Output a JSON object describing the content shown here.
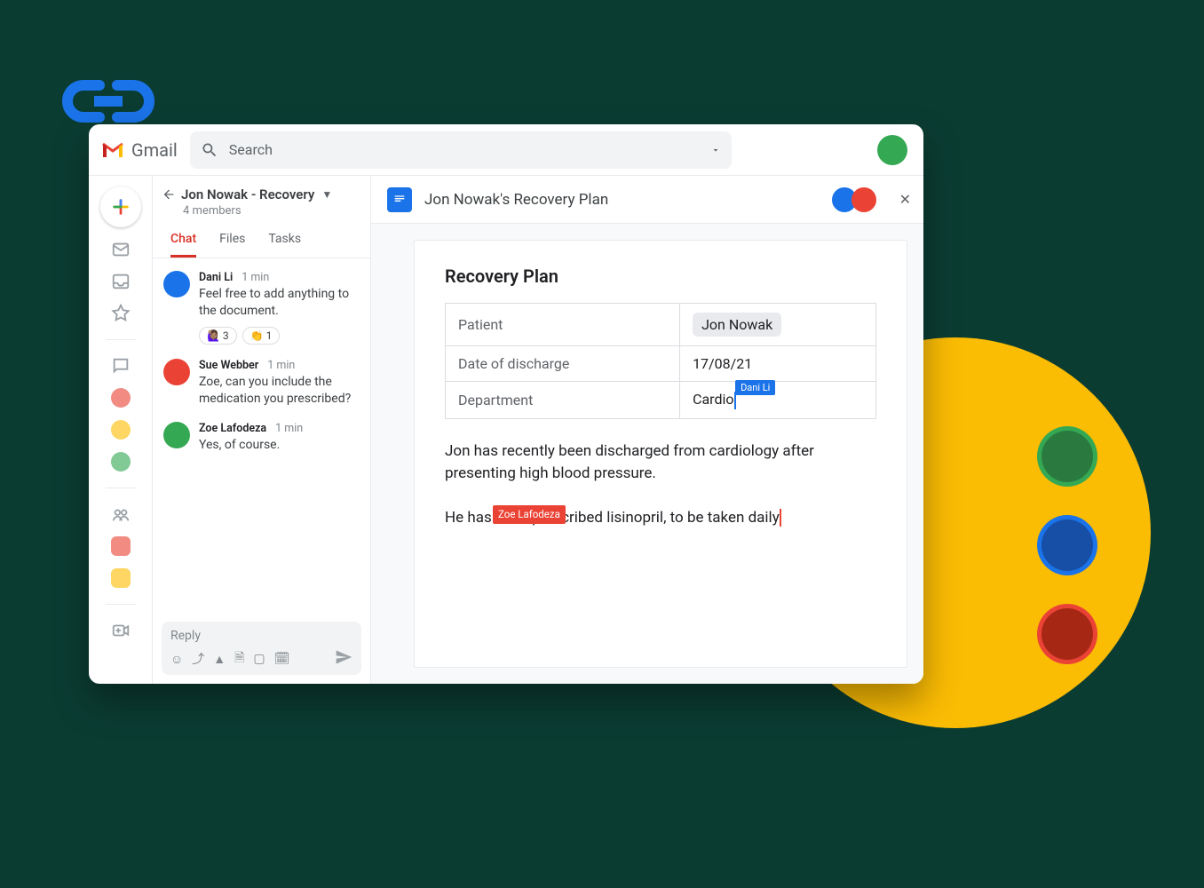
{
  "app": {
    "name": "Gmail",
    "search_placeholder": "Search"
  },
  "space": {
    "title": "Jon Nowak - Recovery",
    "members_label": "4 members",
    "tabs": [
      "Chat",
      "Files",
      "Tasks"
    ],
    "active_tab": "Chat"
  },
  "messages": [
    {
      "author": "Dani Li",
      "time": "1 min",
      "text": "Feel free to add anything to the document.",
      "avatar_color": "#1a73e8",
      "reactions": [
        {
          "emoji": "🙋🏽‍♀️",
          "count": "3"
        },
        {
          "emoji": "👏",
          "count": "1"
        }
      ]
    },
    {
      "author": "Sue Webber",
      "time": "1 min",
      "text": "Zoe, can you include the medication you prescribed?",
      "avatar_color": "#ea4335",
      "reactions": []
    },
    {
      "author": "Zoe Lafodeza",
      "time": "1 min",
      "text": "Yes, of course.",
      "avatar_color": "#34a853",
      "reactions": []
    }
  ],
  "reply": {
    "placeholder": "Reply"
  },
  "document": {
    "title": "Jon Nowak's Recovery Plan",
    "heading": "Recovery Plan",
    "collaborators": [
      {
        "name": "Dani Li",
        "color": "#1a73e8"
      },
      {
        "name": "Zoe Lafodeza",
        "color": "#ea4335"
      }
    ],
    "rows": [
      {
        "label": "Patient",
        "value": "Jon Nowak",
        "pill": true
      },
      {
        "label": "Date of discharge",
        "value": "17/08/21"
      },
      {
        "label": "Department",
        "value": "Cardio",
        "cursor": {
          "name": "Dani Li",
          "color": "#1a73e8"
        }
      }
    ],
    "para1": "Jon has recently been discharged from cardiology after presenting high blood pressure.",
    "para2_pre": "He has been prescribed lisinopril, to be taken daily",
    "cursor2": {
      "name": "Zoe Lafodeza",
      "color": "#ea4335"
    }
  }
}
